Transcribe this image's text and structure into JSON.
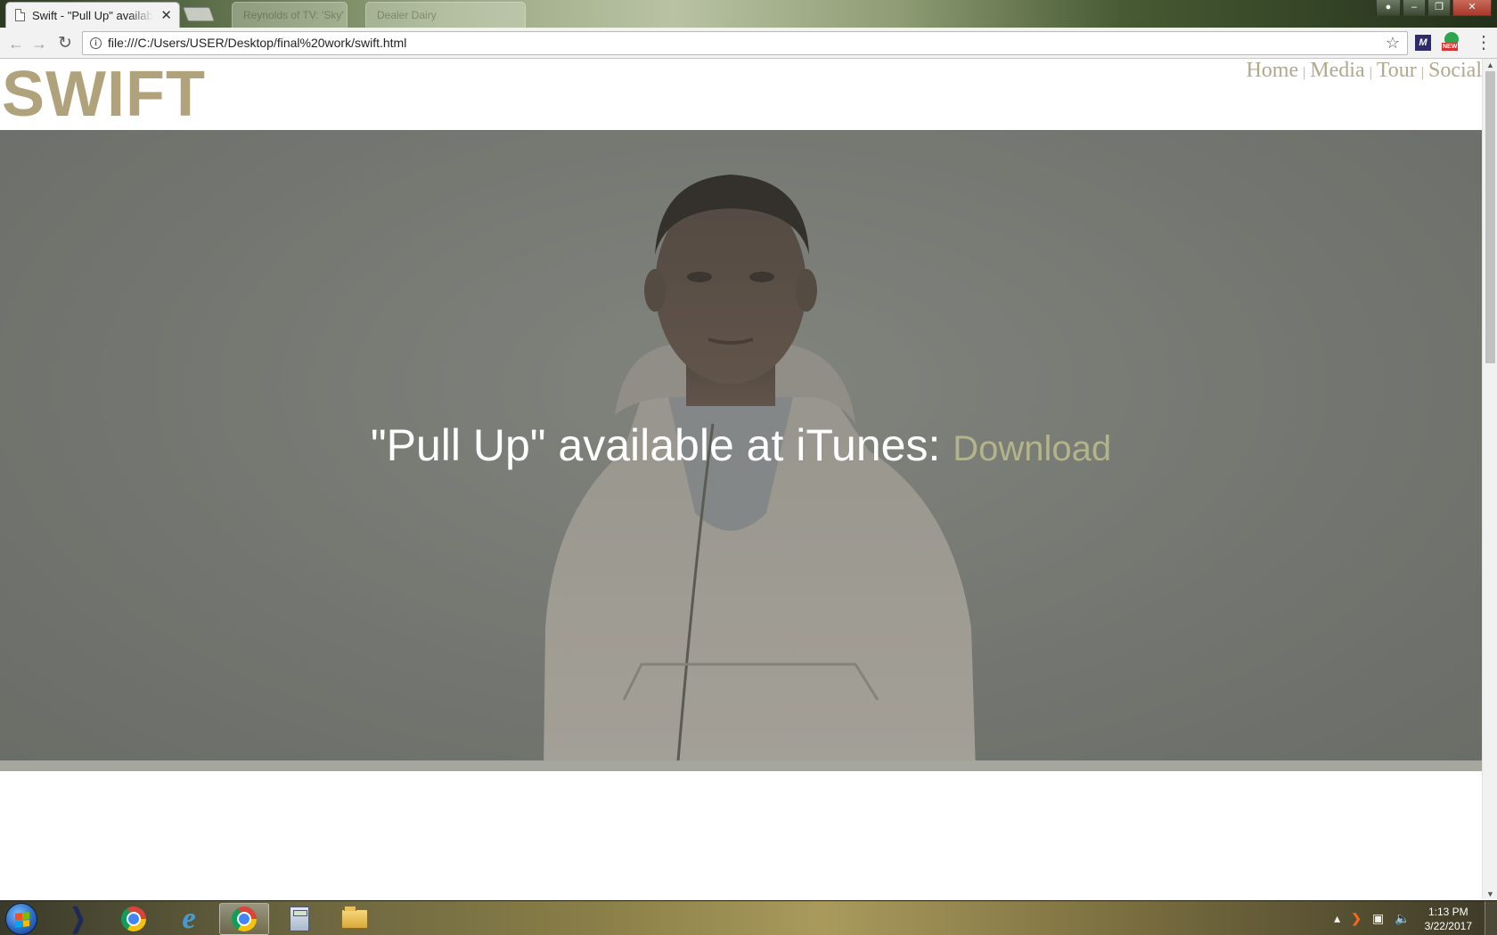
{
  "browser": {
    "active_tab_title": "Swift - \"Pull Up\" available at iTunes",
    "tab_close": "✕",
    "ghost_tabs": [
      "Reynolds of TV: 'Sky'",
      "Dealer Dairy"
    ],
    "url": "file:///C:/Users/USER/Desktop/final%20work/swift.html",
    "extensions": {
      "w_label": "M",
      "new_badge": "NEW"
    }
  },
  "site": {
    "logo": "SWIFT",
    "nav": [
      {
        "label": "Home"
      },
      {
        "label": "Media"
      },
      {
        "label": "Tour"
      },
      {
        "label": "Social"
      }
    ],
    "nav_separator": "|",
    "hero": {
      "promo_text": "\"Pull Up\" available at iTunes: ",
      "download_label": "Download",
      "image_subject": "portrait of young man in grey hoodie"
    }
  },
  "taskbar": {
    "items": [
      {
        "name": "windows-media-center",
        "running": false
      },
      {
        "name": "chrome",
        "running": false
      },
      {
        "name": "internet-explorer",
        "running": false
      },
      {
        "name": "chrome",
        "running": true
      },
      {
        "name": "calculator",
        "running": false
      },
      {
        "name": "file-explorer",
        "running": false
      }
    ],
    "clock_time": "1:13 PM",
    "clock_date": "3/22/2017"
  },
  "colors": {
    "logo": "#b0a37c",
    "nav": "#b0a98c",
    "download_link": "#b3b489",
    "hero_text": "#ffffff"
  }
}
